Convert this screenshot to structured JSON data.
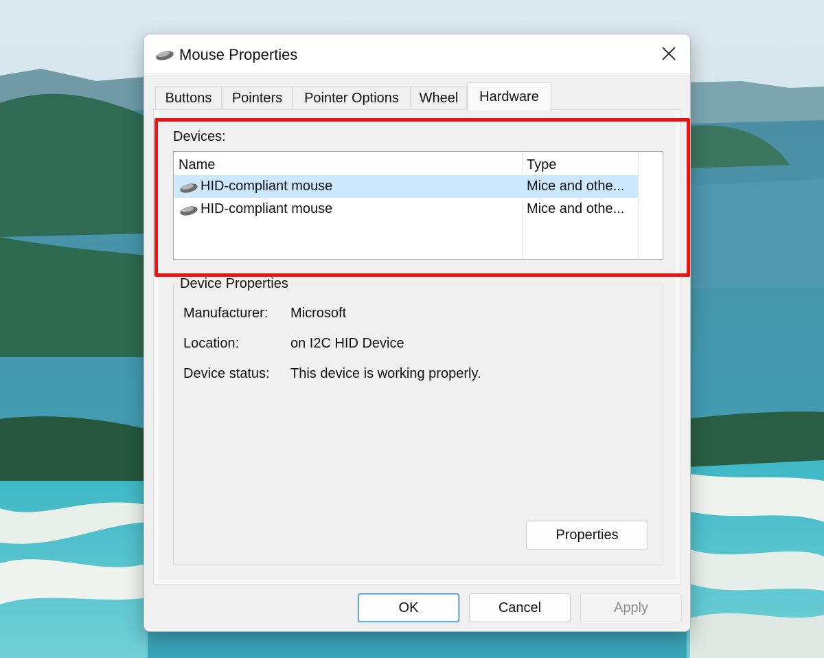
{
  "window": {
    "title": "Mouse Properties",
    "title_icon": "mouse-icon",
    "close_icon": "close-icon"
  },
  "tabs": [
    {
      "label": "Buttons",
      "active": false
    },
    {
      "label": "Pointers",
      "active": false
    },
    {
      "label": "Pointer Options",
      "active": false
    },
    {
      "label": "Wheel",
      "active": false
    },
    {
      "label": "Hardware",
      "active": true
    }
  ],
  "devices": {
    "label": "Devices:",
    "columns": [
      "Name",
      "Type"
    ],
    "rows": [
      {
        "name": "HID-compliant mouse",
        "type": "Mice and othe...",
        "icon": "mouse-icon",
        "selected": true
      },
      {
        "name": "HID-compliant mouse",
        "type": "Mice and othe...",
        "icon": "mouse-icon",
        "selected": false
      }
    ],
    "highlight_color": "#ee1111",
    "selection_color": "#cce8ff"
  },
  "device_properties": {
    "title": "Device Properties",
    "fields": [
      {
        "label": "Manufacturer:",
        "value": "Microsoft"
      },
      {
        "label": "Location:",
        "value": "on I2C HID Device"
      },
      {
        "label": "Device status:",
        "value": "This device is working properly."
      }
    ],
    "properties_button": "Properties"
  },
  "footer": {
    "ok": "OK",
    "cancel": "Cancel",
    "apply": "Apply",
    "apply_disabled": true
  }
}
